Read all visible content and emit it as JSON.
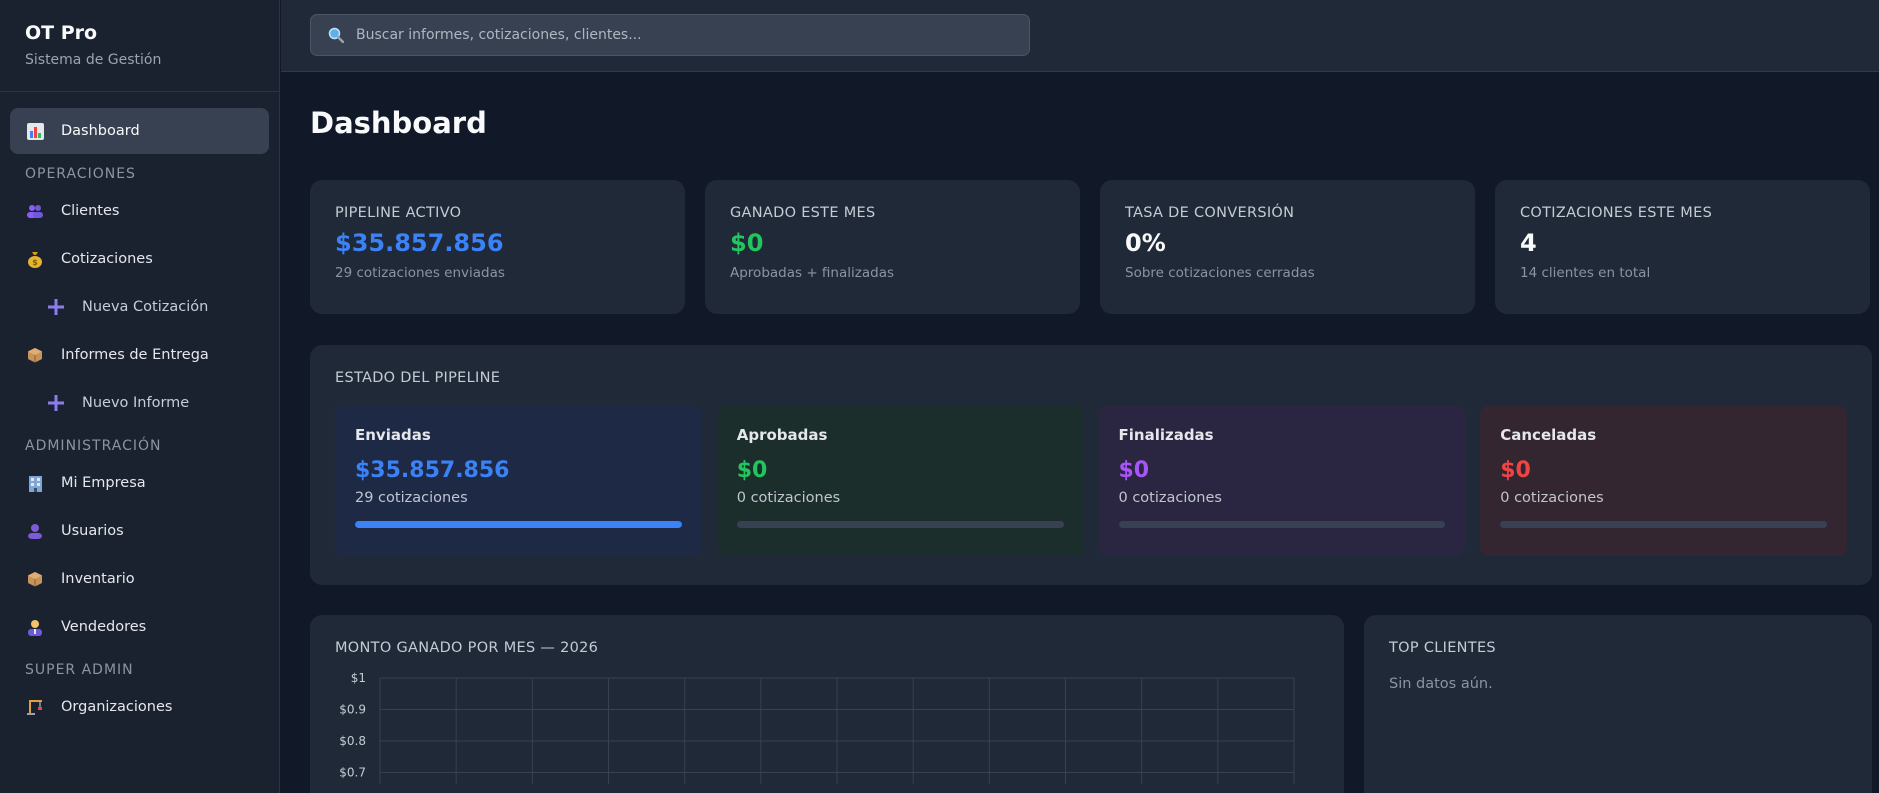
{
  "brand": {
    "title": "OT Pro",
    "subtitle": "Sistema de Gestión"
  },
  "sidebar": {
    "dashboard": {
      "label": "Dashboard",
      "icon": "bar-chart-icon"
    },
    "sections": {
      "operaciones": "OPERACIONES",
      "administracion": "ADMINISTRACIÓN",
      "super_admin": "SUPER ADMIN"
    },
    "items": {
      "clientes": {
        "label": "Clientes",
        "icon": "users-icon"
      },
      "cotizaciones": {
        "label": "Cotizaciones",
        "icon": "money-bag-icon"
      },
      "nueva_cotizacion": {
        "label": "Nueva Cotización",
        "icon": "plus-icon"
      },
      "informes": {
        "label": "Informes de Entrega",
        "icon": "package-icon"
      },
      "nuevo_informe": {
        "label": "Nuevo Informe",
        "icon": "plus-icon"
      },
      "mi_empresa": {
        "label": "Mi Empresa",
        "icon": "building-icon"
      },
      "usuarios": {
        "label": "Usuarios",
        "icon": "user-icon"
      },
      "inventario": {
        "label": "Inventario",
        "icon": "package-icon"
      },
      "vendedores": {
        "label": "Vendedores",
        "icon": "salesperson-icon"
      },
      "organizaciones": {
        "label": "Organizaciones",
        "icon": "construction-icon"
      }
    }
  },
  "search": {
    "placeholder": "Buscar informes, cotizaciones, clientes...",
    "value": ""
  },
  "page": {
    "title": "Dashboard"
  },
  "stats": [
    {
      "label": "PIPELINE ACTIVO",
      "value": "$35.857.856",
      "sub": "29 cotizaciones enviadas",
      "color": "#3b82f6"
    },
    {
      "label": "GANADO ESTE MES",
      "value": "$0",
      "sub": "Aprobadas + finalizadas",
      "color": "#22c55e"
    },
    {
      "label": "TASA DE CONVERSIÓN",
      "value": "0%",
      "sub": "Sobre cotizaciones cerradas",
      "color": "#f9fafb"
    },
    {
      "label": "COTIZACIONES ESTE MES",
      "value": "4",
      "sub": "14 clientes en total",
      "color": "#f9fafb"
    }
  ],
  "pipeline": {
    "title": "ESTADO DEL PIPELINE",
    "stages": [
      {
        "label": "Enviadas",
        "value": "$35.857.856",
        "count": "29 cotizaciones",
        "progress": 1.0,
        "color": "#3b82f6",
        "bg": "#1e2a45"
      },
      {
        "label": "Aprobadas",
        "value": "$0",
        "count": "0 cotizaciones",
        "progress": 0,
        "color": "#22c55e",
        "bg": "#1c2e2c"
      },
      {
        "label": "Finalizadas",
        "value": "$0",
        "count": "0 cotizaciones",
        "progress": 0,
        "color": "#a855f7",
        "bg": "#2a2540"
      },
      {
        "label": "Canceladas",
        "value": "$0",
        "count": "0 cotizaciones",
        "progress": 0,
        "color": "#ef4444",
        "bg": "#332630"
      }
    ]
  },
  "chart_panel": {
    "title": "MONTO GANADO POR MES — 2026"
  },
  "chart_data": {
    "type": "bar",
    "title": "MONTO GANADO POR MES — 2026",
    "yticks": [
      "$1",
      "$0.9",
      "$0.8",
      "$0.7"
    ],
    "ylim": [
      0,
      1
    ],
    "grid": true
  },
  "top_clients": {
    "title": "TOP CLIENTES",
    "empty": "Sin datos aún."
  }
}
